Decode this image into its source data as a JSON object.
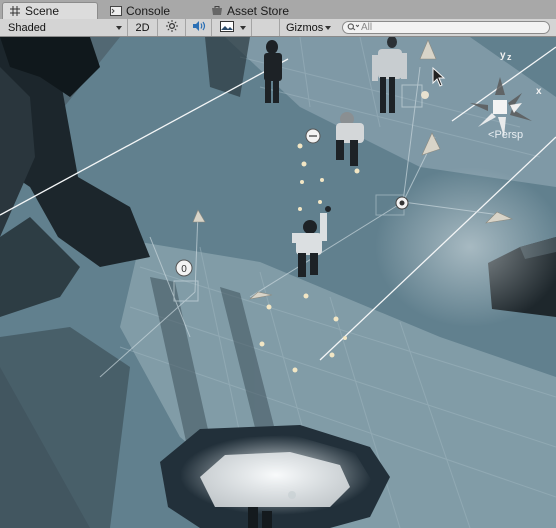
{
  "tabs": [
    {
      "label": "Scene",
      "icon": "grid-icon",
      "active": true
    },
    {
      "label": "Console",
      "icon": "console-icon",
      "active": false
    },
    {
      "label": "Asset Store",
      "icon": "store-icon",
      "active": false
    }
  ],
  "toolbar": {
    "shading_mode": "Shaded",
    "mode_2d": "2D",
    "gizmos": "Gizmos",
    "search_placeholder": "All"
  },
  "scene_gizmo": {
    "axis_y": "y",
    "axis_z": "z",
    "axis_x": "x",
    "projection": "Persp"
  },
  "colors": {
    "tab_bg": "#a8a8a8",
    "toolbar_bg": "#d4d4d4",
    "floor": "#6f8a98",
    "wall_dark": "#1c262c"
  }
}
